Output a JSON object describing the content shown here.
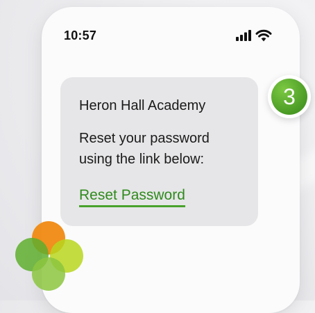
{
  "status_bar": {
    "time": "10:57",
    "signal_icon": "cellular-signal-icon",
    "wifi_icon": "wifi-icon"
  },
  "message": {
    "sender": "Heron Hall Academy",
    "body_lines": [
      "Reset your password",
      "using the link below:"
    ],
    "link_label": "Reset Password"
  },
  "step_badge": {
    "number": "3"
  },
  "logo": {
    "icon": "overlapping-circles-logo"
  },
  "colors": {
    "link": "#2f8a1c",
    "link_underline": "#49a22b",
    "badge": "#4a9b25",
    "card": "#e6e6e8",
    "logo_orange": "#f08a12",
    "logo_green": "#5fae2e",
    "logo_lime": "#b9d61f"
  }
}
